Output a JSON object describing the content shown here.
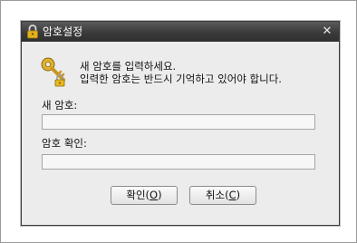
{
  "dialog": {
    "title": "암호설정",
    "message_line1": "새 암호를 입력하세요.",
    "message_line2": "입력한 암호는 반드시 기억하고 있어야 합니다.",
    "new_password": {
      "label": "새 암호:",
      "value": ""
    },
    "confirm_password": {
      "label": "암호 확인:",
      "value": ""
    },
    "ok_button": {
      "label": "확인",
      "mnemonic_open": "(",
      "mnemonic": "O",
      "mnemonic_close": ")"
    },
    "cancel_button": {
      "label": "취소",
      "mnemonic_open": "(",
      "mnemonic": "C",
      "mnemonic_close": ")"
    },
    "close_symbol": "✕"
  },
  "colors": {
    "titlebar": "#3b3b3b",
    "window_bg": "#ececec",
    "lock_gold": "#e3b21c",
    "key_gold": "#d9a52a"
  },
  "icons": {
    "title": "lock-icon",
    "message": "key-icon",
    "close": "close-icon"
  }
}
